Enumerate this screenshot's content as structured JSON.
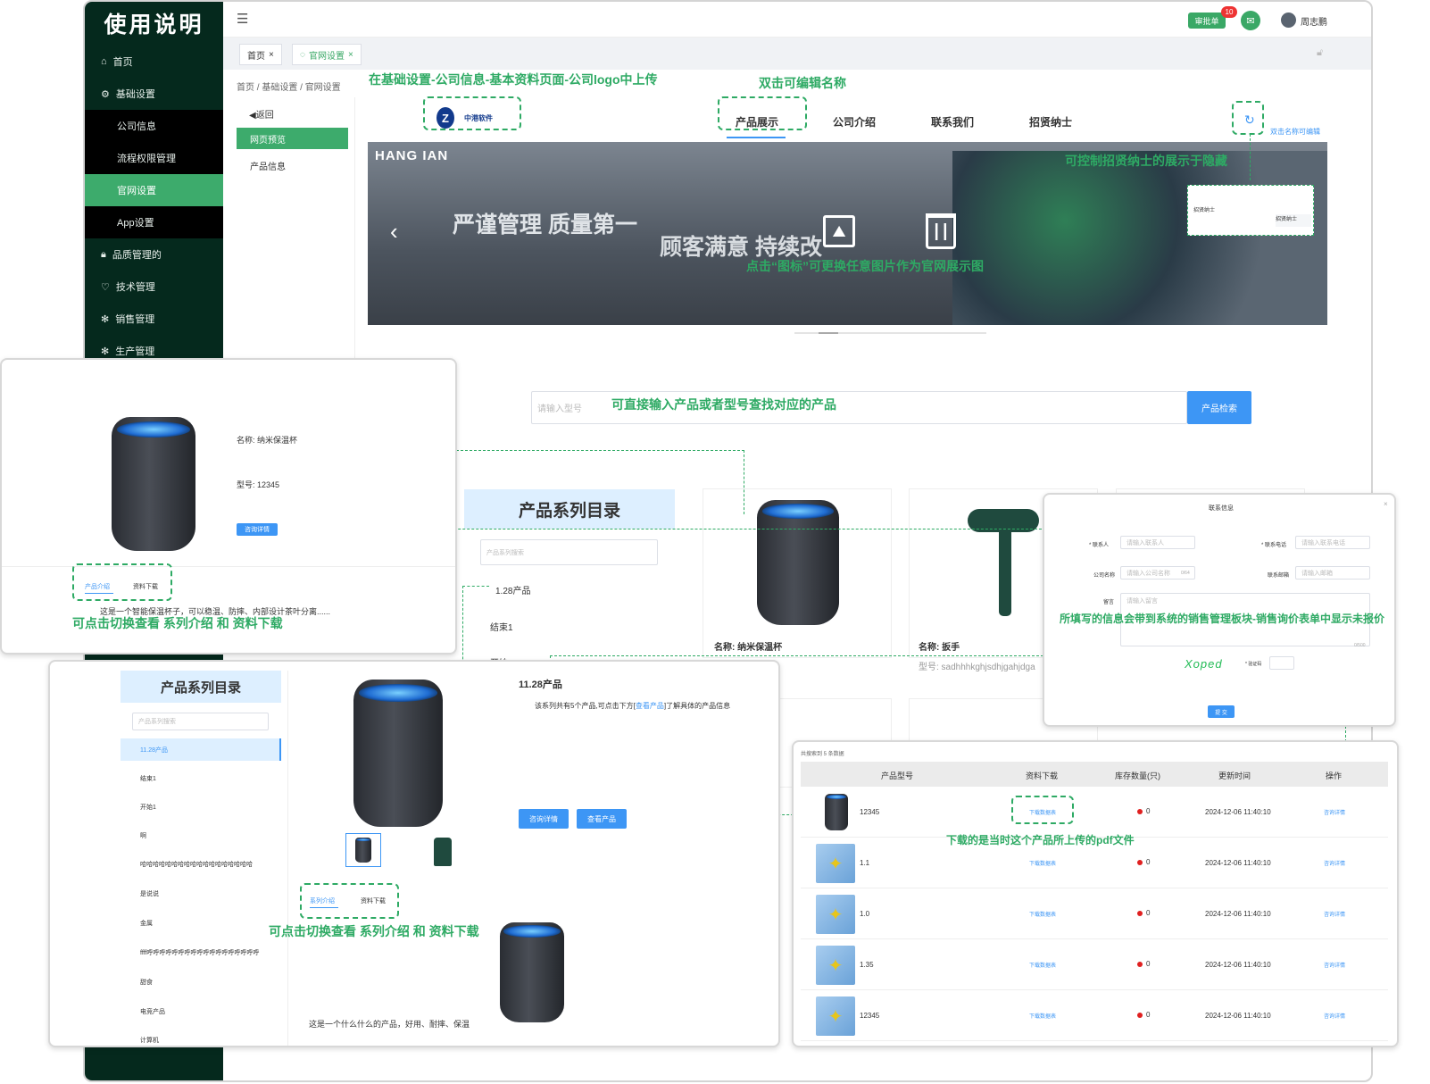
{
  "sidebar": {
    "title": "使用说明",
    "items": [
      {
        "icon": "home-icon",
        "label": "首页"
      },
      {
        "icon": "settings-icon",
        "label": "基础设置"
      },
      {
        "label": "公司信息"
      },
      {
        "label": "流程权限管理"
      },
      {
        "label": "官网设置"
      },
      {
        "label": "App设置"
      },
      {
        "icon": "lock-icon",
        "label": "品质管理的"
      },
      {
        "icon": "heart-icon",
        "label": "技术管理"
      },
      {
        "icon": "gear-icon",
        "label": "销售管理"
      },
      {
        "icon": "gear-icon",
        "label": "生产管理"
      }
    ]
  },
  "topbar": {
    "approve_label": "审批单",
    "badge": "10",
    "user": "周志鹏"
  },
  "tabs": [
    {
      "label": "首页"
    },
    {
      "label": "官网设置"
    }
  ],
  "breadcrumb": {
    "a": "首页",
    "b": "基础设置",
    "c": "官网设置"
  },
  "subnav": {
    "back": "◀返回",
    "preview": "网页预览",
    "product": "产品信息"
  },
  "site": {
    "logo_text": "中港软件",
    "nav": [
      "产品展示",
      "公司介绍",
      "联系我们",
      "招贤纳士"
    ],
    "edit_hint": "双击名称可编辑",
    "banner_brand": "HANG  IAN",
    "banner_text1": "严谨管理  质量第一",
    "banner_text2": "顾客满意  持续改",
    "popup_label": "招贤纳士",
    "search_placeholder": "请输入型号",
    "search_button": "产品检索",
    "catalog_title": "产品系列目录",
    "catalog_search": "产品系列搜索",
    "catalog_items": [
      "1.28产品",
      "结束1",
      "开始1"
    ],
    "card1_name": "名称: 纳米保温杯",
    "card2_name": "名称: 扳手",
    "card2_model": "型号: sadhhhkghjsdhjgahjdga"
  },
  "callouts": {
    "c1": "在基础设置-公司信息-基本资料页面-公司logo中上传",
    "c2": "双击可编辑名称",
    "c3": "可控制招贤纳士的展示于隐藏",
    "c4": "点击“图标”可更换任意图片作为官网展示图",
    "c5": "可直接输入产品或者型号查找对应的产品",
    "c6": "可点击切换查看 系列介绍 和 资料下载",
    "c7": "所填写的信息会带到系统的销售管理板块-销售询价表单中显示未报价",
    "c8": "可点击切换查看 系列介绍 和 资料下载",
    "c9": "下载的是当时这个产品所上传的pdf文件"
  },
  "product_panel": {
    "name": "名称: 纳米保温杯",
    "model": "型号: 12345",
    "button": "咨询详情",
    "tab1": "产品介绍",
    "tab2": "资料下载",
    "desc": "这是一个智能保温杯子，可以稳温、防摔、内部设计茶叶分离......"
  },
  "contact_panel": {
    "title": "联系信息",
    "f1": "* 联系人",
    "p1": "请输入联系人",
    "f2": "* 联系电话",
    "p2": "请输入联系电话",
    "f3": "公司名称",
    "p3": "请输入公司名称",
    "c3": "0/64",
    "f4": "联系邮箱",
    "p4": "请输入邮箱",
    "f5": "留言",
    "p5": "请输入留言",
    "c5": "0/500",
    "captcha": "Xoped",
    "f6": "* 验证码",
    "submit": "提 交"
  },
  "series_panel": {
    "title": "产品系列目录",
    "search": "产品系列搜索",
    "items": [
      "11.28产品",
      "结束1",
      "开始1",
      "啊",
      "哈哈哈哈哈哈哈哈哈哈哈哈哈哈哈哈哈哈",
      "是说说",
      "金属",
      "ffff呼呼呼呼呼呼呼呼呼呼呼呼呼呼呼呼呼呼",
      "甜食",
      "电竞产品",
      "计算机"
    ],
    "heading": "11.28产品",
    "desc_a": "该系列共有5个产品,可点击下方[",
    "desc_link": "查看产品",
    "desc_b": "]了解具体的产品信息",
    "btn1": "咨询详情",
    "btn2": "查看产品",
    "tab1": "系列介绍",
    "tab2": "资料下载",
    "desc2": "这是一个什么什么的产品，好用、耐摔、保温"
  },
  "table_panel": {
    "caption": "共搜索到 5 条数据",
    "headers": [
      "产品型号",
      "资料下载",
      "库存数量(只)",
      "更新时间",
      "操作"
    ],
    "rows": [
      {
        "model": "12345",
        "download": "下载数据表",
        "stock": "0",
        "time": "2024-12-06 11:40:10",
        "op": "咨询详情"
      },
      {
        "model": "1.1",
        "download": "下载数据表",
        "stock": "0",
        "time": "2024-12-06 11:40:10",
        "op": "咨询详情"
      },
      {
        "model": "1.0",
        "download": "下载数据表",
        "stock": "0",
        "time": "2024-12-06 11:40:10",
        "op": "咨询详情"
      },
      {
        "model": "1.35",
        "download": "下载数据表",
        "stock": "0",
        "time": "2024-12-06 11:40:10",
        "op": "咨询详情"
      },
      {
        "model": "12345",
        "download": "下载数据表",
        "stock": "0",
        "time": "2024-12-06 11:40:10",
        "op": "咨询详情"
      }
    ]
  }
}
